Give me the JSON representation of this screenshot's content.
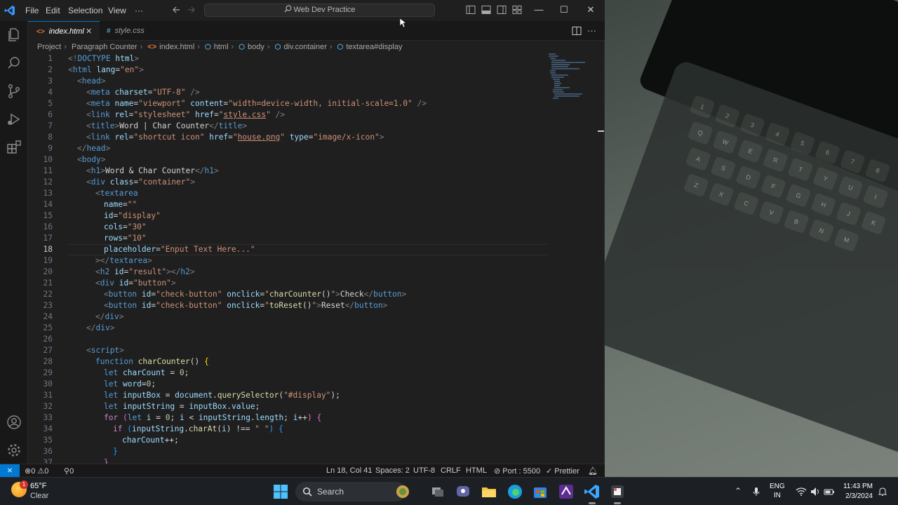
{
  "window": {
    "command_center": "Web Dev Practice",
    "menu": [
      "File",
      "Edit",
      "Selection",
      "View",
      "···"
    ]
  },
  "tabs": [
    {
      "label": "index.html",
      "badge": "<>",
      "active": true
    },
    {
      "label": "style.css",
      "badge": "#",
      "active": false
    }
  ],
  "breadcrumb": [
    "Project",
    "Paragraph Counter",
    "index.html",
    "html",
    "body",
    "div.container",
    "textarea#display"
  ],
  "editor": {
    "active_line": 18,
    "lines": [
      {
        "n": "1"
      },
      {
        "n": "2"
      },
      {
        "n": "3"
      },
      {
        "n": "4"
      },
      {
        "n": "5"
      },
      {
        "n": "6"
      },
      {
        "n": "7"
      },
      {
        "n": "8"
      },
      {
        "n": "9"
      },
      {
        "n": "10"
      },
      {
        "n": "11"
      },
      {
        "n": "12"
      },
      {
        "n": "13"
      },
      {
        "n": "14"
      },
      {
        "n": "15"
      },
      {
        "n": "16"
      },
      {
        "n": "17"
      },
      {
        "n": "18"
      },
      {
        "n": "19"
      },
      {
        "n": "20"
      },
      {
        "n": "21"
      },
      {
        "n": "22"
      },
      {
        "n": "23"
      },
      {
        "n": "24"
      },
      {
        "n": "25"
      },
      {
        "n": "26"
      },
      {
        "n": "27"
      },
      {
        "n": "28"
      },
      {
        "n": "29"
      },
      {
        "n": "30"
      },
      {
        "n": "31"
      },
      {
        "n": "32"
      },
      {
        "n": "33"
      },
      {
        "n": "34"
      },
      {
        "n": "35"
      },
      {
        "n": "36"
      },
      {
        "n": "37"
      }
    ]
  },
  "statusbar": {
    "remote": "⨯",
    "errors": "0",
    "warnings": "0",
    "ports": "0",
    "position": "Ln 18, Col 41",
    "spaces": "Spaces: 2",
    "encoding": "UTF-8",
    "eol": "CRLF",
    "language": "HTML",
    "port": "Port : 5500",
    "formatter": "Prettier"
  },
  "taskbar": {
    "weather_temp": "65°F",
    "weather_cond": "Clear",
    "weather_badge": "1",
    "search_label": "Search",
    "lang_line1": "ENG",
    "lang_line2": "IN",
    "time": "11:43 PM",
    "date": "2/3/2024"
  },
  "colors": {
    "accent": "#0078d4",
    "editor_bg": "#1f1f1f",
    "tag": "#569cd6",
    "attr": "#9cdcfe",
    "string": "#ce9178",
    "function": "#dcdcaa",
    "number": "#b5cea8",
    "control": "#c586c0"
  }
}
